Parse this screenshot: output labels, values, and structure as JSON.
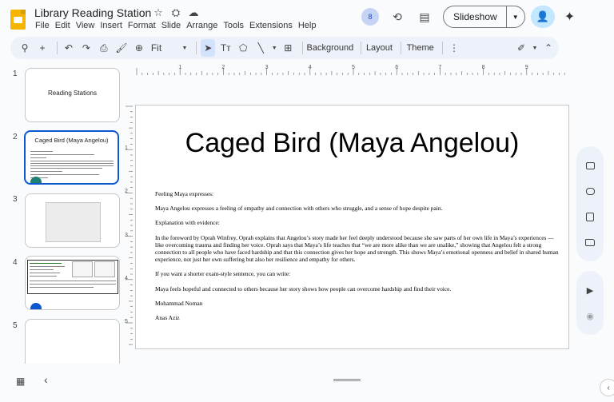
{
  "header": {
    "doc_title": "Library Reading Station",
    "menu": [
      "File",
      "Edit",
      "View",
      "Insert",
      "Format",
      "Slide",
      "Arrange",
      "Tools",
      "Extensions",
      "Help"
    ],
    "avatar_count": "8",
    "slideshow_label": "Slideshow"
  },
  "toolbar": {
    "zoom_value": "Fit",
    "background_label": "Background",
    "layout_label": "Layout",
    "theme_label": "Theme"
  },
  "filmstrip": {
    "slides": [
      {
        "num": "1",
        "title": "Reading Stations"
      },
      {
        "num": "2",
        "title": "Caged Bird (Maya Angelou)"
      },
      {
        "num": "3"
      },
      {
        "num": "4"
      },
      {
        "num": "5"
      }
    ]
  },
  "ruler": {
    "h": [
      "1",
      "2",
      "3",
      "4",
      "5",
      "6",
      "7",
      "8",
      "9"
    ],
    "v": [
      "1",
      "2",
      "3",
      "4",
      "5"
    ]
  },
  "slide": {
    "title": "Caged Bird (Maya Angelou)",
    "body": [
      "Feeling Maya expresses:",
      "Maya Angelou expresses a feeling of empathy and connection with others who struggle, and a sense of hope despite pain.",
      "Explanation with evidence:",
      "In the foreword by Oprah Winfrey, Oprah explains that Angelou’s story made her feel deeply understood because she saw parts of her own life in Maya’s experiences — like overcoming trauma and finding her voice. Oprah says that Maya’s life teaches that “we are more alike than we are unalike,” showing that Angelou felt a strong connection to all people who have faced hardship and that this connection gives her hope and strength. This shows Maya’s emotional openness and belief in shared human experience, not just her own suffering but also her resilience and empathy for others.",
      "If you want a shorter exam-style sentence, you can write:",
      "Maya feels hopeful and connected to others because her story shows how people can overcome hardship and find their voice.",
      "Mohammad Noman",
      "Anas Aziz"
    ]
  },
  "colors": {
    "accent": "#0b57d0",
    "toolbar_bg": "#edf2fa",
    "share_bg": "#c2e7ff",
    "logo": "#f4b400"
  }
}
